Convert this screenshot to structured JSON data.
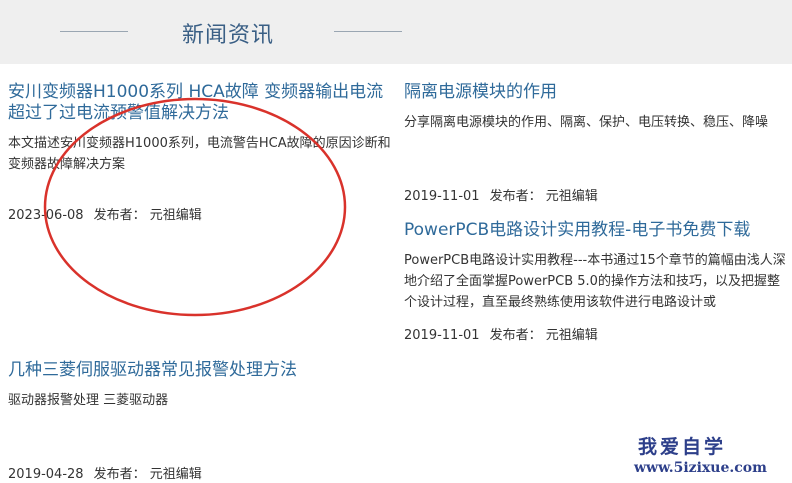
{
  "section": {
    "title": "新闻资讯"
  },
  "articles": [
    {
      "title": "安川变频器H1000系列 HCA故障 变频器输出电流超过了过电流预警值解决方法",
      "desc": "本文描述安川变频器H1000系列，电流警告HCA故障的原因诊断和变频器故障解决方案",
      "date": "2023-06-08",
      "by_label": "发布者：",
      "author": "元祖编辑"
    },
    {
      "title": "隔离电源模块的作用",
      "desc": "分享隔离电源模块的作用、隔离、保护、电压转换、稳压、降噪",
      "date": "2019-11-01",
      "by_label": "发布者：",
      "author": "元祖编辑"
    },
    {
      "title": "PowerPCB电路设计实用教程-电子书免费下载",
      "desc": "PowerPCB电路设计实用教程---本书通过15个章节的篇幅由浅人深地介绍了全面掌握PowerPCB 5.0的操作方法和技巧，以及把握整个设计过程，直至最终熟练使用该软件进行电路设计或",
      "date": "2019-11-01",
      "by_label": "发布者：",
      "author": "元祖编辑"
    },
    {
      "title": "几种三菱伺服驱动器常见报警处理方法",
      "desc": "驱动器报警处理 三菱驱动器",
      "date": "2019-04-28",
      "by_label": "发布者：",
      "author": "元祖编辑"
    }
  ],
  "watermark": {
    "cn": "我爱自学",
    "url": "www.5izixue.com"
  },
  "colors": {
    "link": "#2f6a9a",
    "heading": "#3a5f85",
    "circle": "#d9322b",
    "watermark": "#2d3f8a"
  }
}
